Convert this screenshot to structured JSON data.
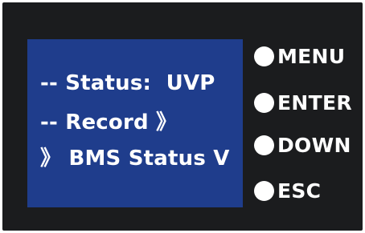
{
  "colors": {
    "panel": "#1b1c1e",
    "screen": "#1f3d8c",
    "text": "#ffffff"
  },
  "screen": {
    "lines": [
      "-- Status:  UVP",
      "-- Record 》",
      "》 BMS Status V"
    ]
  },
  "keys": [
    {
      "label": "MENU",
      "icon": "circle-button"
    },
    {
      "label": "ENTER",
      "icon": "circle-button"
    },
    {
      "label": "DOWN",
      "icon": "circle-button"
    },
    {
      "label": "ESC",
      "icon": "circle-button"
    }
  ]
}
